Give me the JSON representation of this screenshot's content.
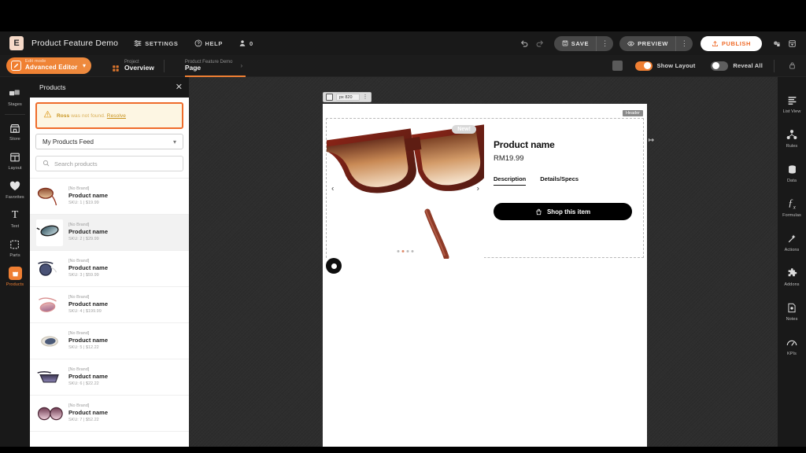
{
  "topbar": {
    "logo": "E",
    "title": "Product Feature Demo",
    "settings_label": "SETTINGS",
    "help_label": "HELP",
    "users_count": "0",
    "undo_icon": "undo-icon",
    "redo_icon": "redo-icon",
    "save_label": "SAVE",
    "preview_label": "PREVIEW",
    "publish_label": "PUBLISH"
  },
  "subbar": {
    "mode_caption": "Edit mode",
    "mode_value": "Advanced Editor",
    "breadcrumb": [
      {
        "caption": "Project",
        "value": "Overview"
      },
      {
        "caption": "Product Feature Demo",
        "value": "Page"
      }
    ],
    "show_layout_label": "Show Layout",
    "show_layout_on": true,
    "reveal_all_label": "Reveal All",
    "reveal_all_on": false
  },
  "left_rail": [
    {
      "label": "Stages",
      "icon": "stages-icon"
    },
    {
      "label": "Store",
      "icon": "store-icon"
    },
    {
      "label": "Layout",
      "icon": "layout-icon"
    },
    {
      "label": "Favorites",
      "icon": "heart-icon"
    },
    {
      "label": "Text",
      "icon": "text-icon"
    },
    {
      "label": "Parts",
      "icon": "parts-icon"
    },
    {
      "label": "Products",
      "icon": "products-icon"
    }
  ],
  "right_rail": [
    {
      "label": "List View",
      "icon": "list-view-icon"
    },
    {
      "label": "Rules",
      "icon": "rules-icon"
    },
    {
      "label": "Data",
      "icon": "database-icon"
    },
    {
      "label": "Formulas",
      "icon": "formulas-icon"
    },
    {
      "label": "Actions",
      "icon": "wand-icon"
    },
    {
      "label": "Addons",
      "icon": "puzzle-icon"
    },
    {
      "label": "Notes",
      "icon": "notes-icon"
    },
    {
      "label": "KPIs",
      "icon": "kpis-icon"
    }
  ],
  "panel": {
    "title": "Products",
    "close_icon": "close-icon",
    "alert": {
      "bold": "Ross",
      "text": " was not found. ",
      "link": "Resolve",
      "icon": "warning-icon",
      "border_color": "#ef6c2b"
    },
    "feed_select": "My Products Feed",
    "search_placeholder": "Search products",
    "products": [
      {
        "brand": "[No Brand]",
        "name": "Product name",
        "meta": "SKU: 1 | $19.99",
        "selected": false
      },
      {
        "brand": "[No Brand]",
        "name": "Product name",
        "meta": "SKU: 2 | $29.99",
        "selected": true
      },
      {
        "brand": "[No Brand]",
        "name": "Product name",
        "meta": "SKU: 3 | $59.99",
        "selected": false
      },
      {
        "brand": "[No Brand]",
        "name": "Product name",
        "meta": "SKU: 4 | $199.99",
        "selected": false
      },
      {
        "brand": "[No Brand]",
        "name": "Product name",
        "meta": "SKU: 5 | $12.22",
        "selected": false
      },
      {
        "brand": "[No Brand]",
        "name": "Product name",
        "meta": "SKU: 6 | $22.22",
        "selected": false
      },
      {
        "brand": "[No Brand]",
        "name": "Product name",
        "meta": "SKU: 7 | $52.22",
        "selected": false
      }
    ]
  },
  "canvas": {
    "tool_value": "px 820",
    "section_tag": "Header",
    "new_badge": "New!",
    "prev_arrow": "‹",
    "next_arrow": "›",
    "product_name": "Product name",
    "product_price": "RM19.99",
    "tabs": [
      {
        "label": "Description",
        "active": true
      },
      {
        "label": "Details/Specs",
        "active": false
      }
    ],
    "shop_button": "Shop this item"
  },
  "colors": {
    "accent": "#ef7f33",
    "publish_text": "#ef6c2b",
    "alert_bg": "#fdf6e3",
    "panel_bg": "#ffffff",
    "chrome_bg": "#191919"
  }
}
